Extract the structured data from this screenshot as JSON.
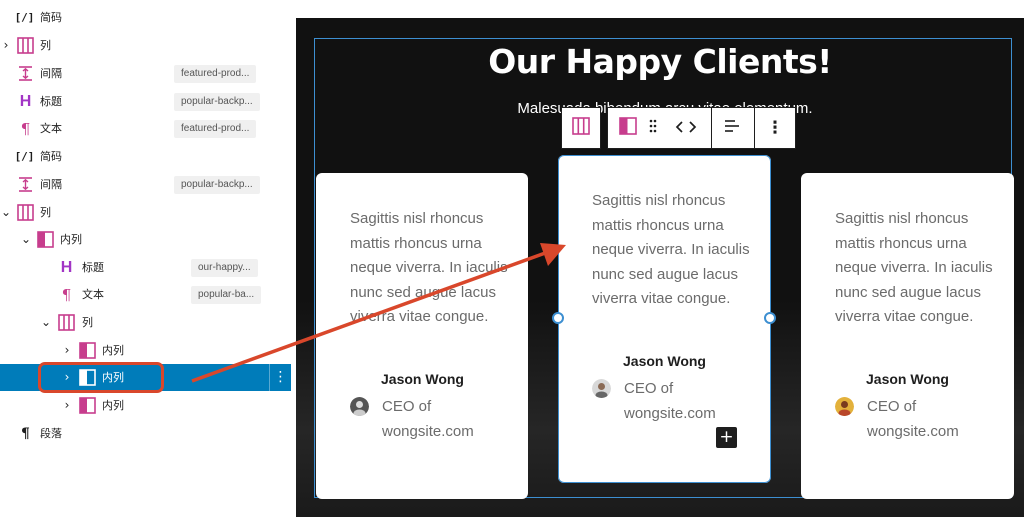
{
  "list_view": {
    "rows": [
      {
        "label": "简码",
        "icon": "shortcode-icon",
        "anchor": ""
      },
      {
        "label": "列",
        "icon": "columns-icon",
        "anchor": ""
      },
      {
        "label": "间隔",
        "icon": "spacer-icon",
        "anchor": "featured-prod..."
      },
      {
        "label": "标题",
        "icon": "heading-icon",
        "anchor": "popular-backp..."
      },
      {
        "label": "文本",
        "icon": "paragraph-icon",
        "anchor": "featured-prod..."
      },
      {
        "label": "简码",
        "icon": "shortcode-icon",
        "anchor": ""
      },
      {
        "label": "间隔",
        "icon": "spacer-icon",
        "anchor": "popular-backp..."
      },
      {
        "label": "列",
        "icon": "columns-icon",
        "anchor": ""
      },
      {
        "label": "内列",
        "icon": "column-icon",
        "anchor": ""
      },
      {
        "label": "标题",
        "icon": "heading-icon",
        "anchor": "our-happy..."
      },
      {
        "label": "文本",
        "icon": "paragraph-icon",
        "anchor": "popular-ba..."
      },
      {
        "label": "列",
        "icon": "columns-icon",
        "anchor": ""
      },
      {
        "label": "内列",
        "icon": "column-icon",
        "anchor": ""
      },
      {
        "label": "内列",
        "icon": "column-icon",
        "anchor": ""
      },
      {
        "label": "内列",
        "icon": "column-icon",
        "anchor": ""
      },
      {
        "label": "段落",
        "icon": "paragraph-icon",
        "anchor": ""
      }
    ],
    "selected_row": 13
  },
  "canvas": {
    "title": "Our Happy Clients!",
    "subtitle": "Malesuada bibendum arcu vitae elementum.",
    "cards": [
      {
        "quote": "Sagittis nisl rhoncus mattis rhoncus urna neque viverra. In iaculis nunc sed augue lacus viverra vitae congue.",
        "name": "Jason Wong",
        "role": "CEO of wongsite.com"
      },
      {
        "quote": "Sagittis nisl rhoncus mattis rhoncus urna neque viverra. In iaculis nunc sed augue lacus viverra vitae congue.",
        "name": "Jason Wong",
        "role": "CEO of wongsite.com"
      },
      {
        "quote": "Sagittis nisl rhoncus mattis rhoncus urna neque viverra. In iaculis nunc sed augue lacus viverra vitae congue.",
        "name": "Jason Wong",
        "role": "CEO of wongsite.com"
      }
    ],
    "add_block_symbol": "+"
  },
  "toolbar": {
    "more_symbol": "⋮"
  },
  "colors": {
    "accent": "#007cba",
    "selection_outline": "#3d8fd1",
    "annotation": "#d9472b",
    "column_icon": "#c73d8d",
    "heading_icon": "#a235c5"
  }
}
